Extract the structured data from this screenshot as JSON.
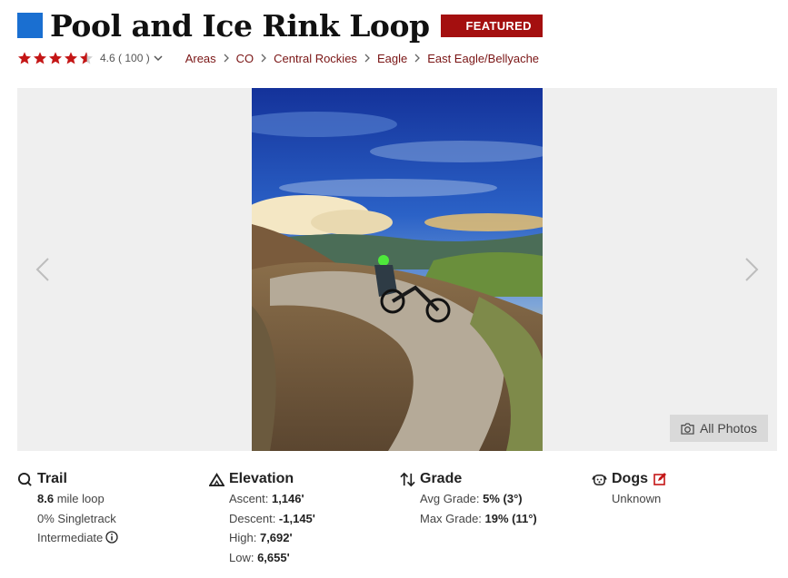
{
  "header": {
    "title": "Pool and Ice Rink Loop",
    "badge": "FEATURED",
    "accent_color": "#1a6fd1",
    "badge_color": "#a40f0f"
  },
  "rating": {
    "stars_value": 4.6,
    "stars_max": 5,
    "text": "4.6 ( 100 )",
    "star_color": "#c41616"
  },
  "breadcrumb": [
    "Areas",
    "CO",
    "Central Rockies",
    "Eagle",
    "East Eagle/Bellyache"
  ],
  "gallery": {
    "all_photos_label": "All Photos"
  },
  "stats": {
    "trail": {
      "heading": "Trail",
      "distance_value": "8.6",
      "distance_suffix": " mile loop",
      "singletrack": "0% Singletrack",
      "difficulty": "Intermediate"
    },
    "elevation": {
      "heading": "Elevation",
      "ascent_label": "Ascent: ",
      "ascent_value": "1,146'",
      "descent_label": "Descent: ",
      "descent_value": "-1,145'",
      "high_label": "High: ",
      "high_value": "7,692'",
      "low_label": "Low: ",
      "low_value": "6,655'"
    },
    "grade": {
      "heading": "Grade",
      "avg_label": "Avg Grade: ",
      "avg_value": "5% (3°)",
      "max_label": "Max Grade: ",
      "max_value": "19% (11°)"
    },
    "dogs": {
      "heading": "Dogs",
      "value": "Unknown"
    }
  }
}
